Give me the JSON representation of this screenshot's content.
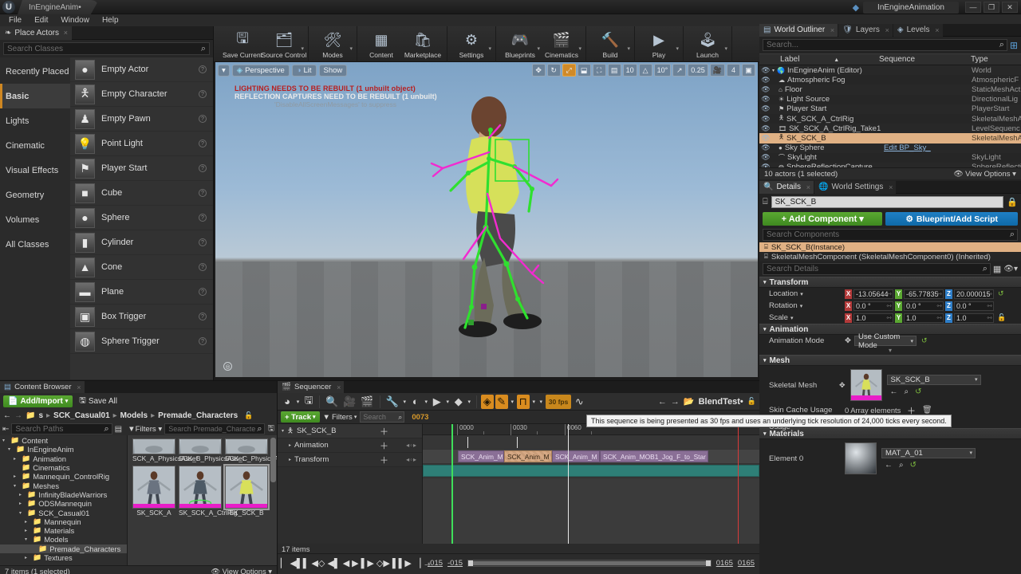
{
  "titlebar": {
    "project_tab": "InEngineAnim•",
    "window_title": "InEngineAnimation",
    "minimize": "—",
    "maximize": "❐",
    "close": "✕"
  },
  "menubar": {
    "items": [
      "File",
      "Edit",
      "Window",
      "Help"
    ]
  },
  "place_actors": {
    "tab_label": "Place Actors",
    "tab_close": "×",
    "search_placeholder": "Search Classes",
    "categories": [
      {
        "label": "Recently Placed",
        "selected": false
      },
      {
        "label": "Basic",
        "selected": true
      },
      {
        "label": "Lights",
        "selected": false
      },
      {
        "label": "Cinematic",
        "selected": false
      },
      {
        "label": "Visual Effects",
        "selected": false
      },
      {
        "label": "Geometry",
        "selected": false
      },
      {
        "label": "Volumes",
        "selected": false
      },
      {
        "label": "All Classes",
        "selected": false
      }
    ],
    "items": [
      {
        "label": "Empty Actor",
        "icon": "sphere-icon"
      },
      {
        "label": "Empty Character",
        "icon": "character-icon"
      },
      {
        "label": "Empty Pawn",
        "icon": "pawn-icon"
      },
      {
        "label": "Point Light",
        "icon": "bulb-icon"
      },
      {
        "label": "Player Start",
        "icon": "playerstart-icon"
      },
      {
        "label": "Cube",
        "icon": "cube-icon"
      },
      {
        "label": "Sphere",
        "icon": "sphere-icon"
      },
      {
        "label": "Cylinder",
        "icon": "cylinder-icon"
      },
      {
        "label": "Cone",
        "icon": "cone-icon"
      },
      {
        "label": "Plane",
        "icon": "plane-icon"
      },
      {
        "label": "Box Trigger",
        "icon": "box-trigger-icon"
      },
      {
        "label": "Sphere Trigger",
        "icon": "sphere-trigger-icon"
      }
    ],
    "help_glyph": "?"
  },
  "main_toolbar": {
    "buttons": [
      {
        "label": "Save Current",
        "icon": "save-icon",
        "caret": false
      },
      {
        "label": "Source Control",
        "icon": "source-control-icon",
        "caret": true
      },
      {
        "label": "Modes",
        "icon": "modes-icon",
        "caret": true
      },
      {
        "label": "Content",
        "icon": "content-icon",
        "caret": false
      },
      {
        "label": "Marketplace",
        "icon": "marketplace-icon",
        "caret": false
      },
      {
        "label": "Settings",
        "icon": "settings-icon",
        "caret": true
      },
      {
        "label": "Blueprints",
        "icon": "blueprints-icon",
        "caret": true
      },
      {
        "label": "Cinematics",
        "icon": "cinematics-icon",
        "caret": true
      },
      {
        "label": "Build",
        "icon": "build-icon",
        "caret": true
      },
      {
        "label": "Play",
        "icon": "play-icon",
        "caret": true
      },
      {
        "label": "Launch",
        "icon": "launch-icon",
        "caret": true
      }
    ]
  },
  "viewport": {
    "menu_caret": "▾",
    "perspective": "Perspective",
    "lit": "Lit",
    "show": "Show",
    "messages": {
      "lighting": "LIGHTING NEEDS TO BE REBUILT (1 unbuilt object)",
      "reflection": "REFLECTION CAPTURES NEED TO BE REBUILT (1 unbuilt)",
      "suppress": "'DisableAllScreenMessages' to suppress"
    },
    "right_controls": [
      {
        "name": "select-move-icon",
        "glyph": "✥",
        "active": false
      },
      {
        "name": "rotate-icon",
        "glyph": "↻",
        "active": false
      },
      {
        "name": "scale-icon",
        "glyph": "⤢",
        "active": true
      },
      {
        "name": "coordinate-space-icon",
        "glyph": "⬓",
        "active": false
      },
      {
        "name": "surface-snap-icon",
        "glyph": "⛶",
        "active": false
      },
      {
        "name": "grid-snap-icon",
        "glyph": "▤",
        "active": false
      },
      {
        "name": "grid-size-value",
        "glyph": "10",
        "active": false
      },
      {
        "name": "rotation-snap-icon",
        "glyph": "△",
        "active": false
      },
      {
        "name": "rotation-snap-value",
        "glyph": "10°",
        "active": false
      },
      {
        "name": "scale-snap-icon",
        "glyph": "↗",
        "active": false
      },
      {
        "name": "scale-snap-value",
        "glyph": "0.25",
        "active": false
      },
      {
        "name": "camera-speed-icon",
        "glyph": "🎥",
        "active": false
      },
      {
        "name": "camera-speed-value",
        "glyph": "4",
        "active": false
      },
      {
        "name": "maximize-viewport-icon",
        "glyph": "▣",
        "active": false
      }
    ],
    "corner_glyph": "◎"
  },
  "world_outliner": {
    "tabs": [
      {
        "label": "World Outliner",
        "icon": "outliner-icon",
        "active": true
      },
      {
        "label": "Layers",
        "icon": "layers-icon",
        "active": false
      },
      {
        "label": "Levels",
        "icon": "levels-icon",
        "active": false
      }
    ],
    "search_placeholder": "Search...",
    "columns": {
      "label": "Label",
      "sequence": "Sequence",
      "type": "Type"
    },
    "sort_arrow": "▲",
    "rows": [
      {
        "label": "InEngineAnim (Editor)",
        "sequence": "",
        "type": "World",
        "icon": "world-icon",
        "indent": 0,
        "selected": false,
        "expander": "▾"
      },
      {
        "label": "Atmospheric Fog",
        "sequence": "",
        "type": "AtmosphericF",
        "icon": "fog-icon",
        "indent": 1,
        "selected": false,
        "expander": ""
      },
      {
        "label": "Floor",
        "sequence": "",
        "type": "StaticMeshAct",
        "icon": "mesh-icon",
        "indent": 1,
        "selected": false,
        "expander": ""
      },
      {
        "label": "Light Source",
        "sequence": "",
        "type": "DirectionalLig",
        "icon": "light-icon",
        "indent": 1,
        "selected": false,
        "expander": ""
      },
      {
        "label": "Player Start",
        "sequence": "",
        "type": "PlayerStart",
        "icon": "playerstart-icon",
        "indent": 1,
        "selected": false,
        "expander": ""
      },
      {
        "label": "SK_SCK_A_CtrlRig",
        "sequence": "",
        "type": "SkeletalMeshA",
        "icon": "skeletal-icon",
        "indent": 1,
        "selected": false,
        "expander": ""
      },
      {
        "label": "SK_SCK_A_CtrlRig_Take1",
        "sequence": "",
        "type": "LevelSequenc",
        "icon": "sequence-icon",
        "indent": 1,
        "selected": false,
        "expander": ""
      },
      {
        "label": "SK_SCK_B",
        "sequence": "",
        "type": "SkeletalMeshA",
        "icon": "skeletal-icon",
        "indent": 1,
        "selected": true,
        "expander": ""
      },
      {
        "label": "Sky Sphere",
        "sequence": "Edit BP_Sky_",
        "type": "",
        "icon": "sphere-icon",
        "indent": 1,
        "selected": false,
        "expander": ""
      },
      {
        "label": "SkyLight",
        "sequence": "",
        "type": "SkyLight",
        "icon": "skylight-icon",
        "indent": 1,
        "selected": false,
        "expander": ""
      },
      {
        "label": "SphereReflectionCapture",
        "sequence": "",
        "type": "SphereReflecti",
        "icon": "reflection-icon",
        "indent": 1,
        "selected": false,
        "expander": ""
      }
    ],
    "footer_count": "10 actors (1 selected)",
    "view_options": "View Options"
  },
  "details": {
    "tabs": [
      {
        "label": "Details",
        "icon": "details-icon",
        "active": true
      },
      {
        "label": "World Settings",
        "icon": "world-settings-icon",
        "active": false
      }
    ],
    "actor_name": "SK_SCK_B",
    "lock_icon": "lock-icon",
    "add_component": "+ Add Component ▾",
    "blueprint_button": "Blueprint/Add Script",
    "search_components_placeholder": "Search Components",
    "components": [
      {
        "label": "SK_SCK_B(Instance)",
        "selected": true
      },
      {
        "label": "SkeletalMeshComponent (SkeletalMeshComponent0) (Inherited)",
        "selected": false
      }
    ],
    "search_details_placeholder": "Search Details",
    "sections": {
      "transform": "Transform",
      "animation": "Animation",
      "mesh": "Mesh",
      "materials": "Materials"
    },
    "transform": {
      "location_label": "Location",
      "rotation_label": "Rotation",
      "scale_label": "Scale",
      "location": {
        "x": "-13.05644",
        "y": "-65.77835",
        "z": "20.000015"
      },
      "rotation": {
        "x": "0.0 °",
        "y": "0.0 °",
        "z": "0.0 °"
      },
      "scale": {
        "x": "1.0",
        "y": "1.0",
        "z": "1.0"
      },
      "axis_labels": {
        "x": "X",
        "y": "Y",
        "z": "Z"
      },
      "reset_glyph": "↺"
    },
    "animation": {
      "mode_label": "Animation Mode",
      "mode_value": "Use Custom Mode"
    },
    "mesh": {
      "skeletal_mesh_label": "Skeletal Mesh",
      "skeletal_mesh_value": "SK_SCK_B",
      "skin_cache_label": "Skin Cache Usage",
      "skin_cache_value": "0 Array elements",
      "skin_deltas_label": "Pre/Post Skin Deltas Usage",
      "skin_deltas_value": "0 Array elements"
    },
    "materials": {
      "element0_label": "Element 0",
      "element0_value": "MAT_A_01"
    }
  },
  "tooltip": {
    "text": "This sequence is being presented as 30 fps and uses an underlying tick resolution of 24,000 ticks every second."
  },
  "content_browser": {
    "tab_label": "Content Browser",
    "tab_close": "×",
    "add_import": "Add/Import",
    "save_all": "Save All",
    "breadcrumb": [
      "s",
      "SCK_Casual01",
      "Models",
      "Premade_Characters"
    ],
    "breadcrumb_sep": "▸",
    "search_paths_placeholder": "Search Paths",
    "filters_label": "Filters",
    "asset_search_placeholder": "Search Premade_Characte",
    "tree": [
      {
        "label": "Content",
        "depth": 0,
        "expander": "▾",
        "selected": false
      },
      {
        "label": "InEngineAnim",
        "depth": 1,
        "expander": "▾",
        "selected": false
      },
      {
        "label": "Animation",
        "depth": 2,
        "expander": "▸",
        "selected": false
      },
      {
        "label": "Cinematics",
        "depth": 2,
        "expander": "",
        "selected": false
      },
      {
        "label": "Mannequin_ControlRig",
        "depth": 2,
        "expander": "▸",
        "selected": false
      },
      {
        "label": "Meshes",
        "depth": 2,
        "expander": "▾",
        "selected": false
      },
      {
        "label": "InfinityBladeWarriors",
        "depth": 3,
        "expander": "▸",
        "selected": false
      },
      {
        "label": "ODSMannequin",
        "depth": 3,
        "expander": "▸",
        "selected": false
      },
      {
        "label": "SCK_Casual01",
        "depth": 3,
        "expander": "▾",
        "selected": false
      },
      {
        "label": "Mannequin",
        "depth": 4,
        "expander": "▸",
        "selected": false
      },
      {
        "label": "Materials",
        "depth": 4,
        "expander": "▸",
        "selected": false
      },
      {
        "label": "Models",
        "depth": 4,
        "expander": "▾",
        "selected": false
      },
      {
        "label": "Premade_Characters",
        "depth": 5,
        "expander": "",
        "selected": true
      },
      {
        "label": "Textures",
        "depth": 4,
        "expander": "▸",
        "selected": false
      }
    ],
    "assets": [
      {
        "name": "SCK_A_PhysicsAsset",
        "selected": false,
        "partial": true
      },
      {
        "name": "SCK_B_PhysicsAsset",
        "selected": false,
        "partial": true
      },
      {
        "name": "SCK_C_PhysicsAsset",
        "selected": false,
        "partial": true
      },
      {
        "name": "SK_SCK_A",
        "selected": false,
        "partial": false
      },
      {
        "name": "SK_SCK_A_CtrlRig",
        "selected": false,
        "partial": false
      },
      {
        "name": "SK_SCK_B",
        "selected": true,
        "partial": false
      }
    ],
    "footer_count": "7 items (1 selected)",
    "view_options": "View Options"
  },
  "sequencer": {
    "tab_label": "Sequencer",
    "tab_close": "×",
    "toolbar": [
      {
        "name": "general-options-icon",
        "glyph": "◕",
        "active": false,
        "caret": true
      },
      {
        "name": "save-sequence-icon",
        "glyph": "🖫",
        "active": false,
        "caret": false
      },
      {
        "name": "find-icon",
        "glyph": "🔍",
        "active": false,
        "caret": false
      },
      {
        "name": "create-camera-icon",
        "glyph": "🎥",
        "active": false,
        "caret": false
      },
      {
        "name": "render-movie-icon",
        "glyph": "🎬",
        "active": false,
        "caret": false
      },
      {
        "name": "actions-icon",
        "glyph": "🔧",
        "active": false,
        "caret": true
      },
      {
        "name": "view-options-icon",
        "glyph": "◐",
        "active": false,
        "caret": true
      },
      {
        "name": "playback-options-icon",
        "glyph": "▶",
        "active": false,
        "caret": true
      },
      {
        "name": "keyframe-options-icon",
        "glyph": "◆",
        "active": false,
        "caret": true
      },
      {
        "name": "auto-key-icon",
        "glyph": "◈",
        "active": true,
        "caret": false
      },
      {
        "name": "key-interpolation-icon",
        "glyph": "✎",
        "active": true,
        "caret": true
      },
      {
        "name": "snapping-icon",
        "glyph": "⊓",
        "active": true,
        "caret": true
      },
      {
        "name": "fps-selector",
        "glyph": "30 fps",
        "active": true,
        "caret": true
      },
      {
        "name": "curve-editor-icon",
        "glyph": "∿",
        "active": false,
        "caret": false
      }
    ],
    "nav_prev": "←",
    "nav_next": "→",
    "breadcrumb_icon": "folder-icon",
    "breadcrumb_label": "BlendTest•",
    "lock_icon": "lock-icon",
    "track_button": "+ Track",
    "filters_button": "Filters",
    "search_placeholder": "Search",
    "current_frame": "0073",
    "tracks": [
      {
        "label": "SK_SCK_B",
        "type": "object",
        "expander": "▾",
        "icon": "skeletal-icon"
      },
      {
        "label": "Animation",
        "type": "child",
        "expander": "▸",
        "icon": ""
      },
      {
        "label": "Transform",
        "type": "child",
        "expander": "▸",
        "icon": ""
      }
    ],
    "ruler_ticks": [
      "0000",
      "0030",
      "0060"
    ],
    "clips": [
      {
        "label": "SCK_Anim_M",
        "selected": false
      },
      {
        "label": "SCK_Anim_M",
        "selected": true
      },
      {
        "label": "SCK_Anim_M",
        "selected": false
      },
      {
        "label": "SCK_Anim_MOB1_Jog_F_to_Star",
        "selected": false
      }
    ],
    "items_count": "17 items",
    "transport": [
      {
        "name": "jump-to-start-icon",
        "glyph": "▏"
      },
      {
        "name": "step-back-large-icon",
        "glyph": "◀▌▌"
      },
      {
        "name": "previous-key-icon",
        "glyph": "◀◇"
      },
      {
        "name": "step-back-icon",
        "glyph": "◀▌"
      },
      {
        "name": "play-reverse-icon",
        "glyph": "◀"
      },
      {
        "name": "play-icon",
        "glyph": "▶"
      },
      {
        "name": "step-forward-icon",
        "glyph": "▌▶"
      },
      {
        "name": "next-key-icon",
        "glyph": "◇▶"
      },
      {
        "name": "step-forward-large-icon",
        "glyph": "▌▌▶"
      },
      {
        "name": "jump-to-end-icon",
        "glyph": "▕"
      },
      {
        "name": "loop-icon",
        "glyph": "→"
      }
    ],
    "range": {
      "start_outer": "-015",
      "start_inner": "-015",
      "end_inner": "0165",
      "end_outer": "0165"
    }
  }
}
